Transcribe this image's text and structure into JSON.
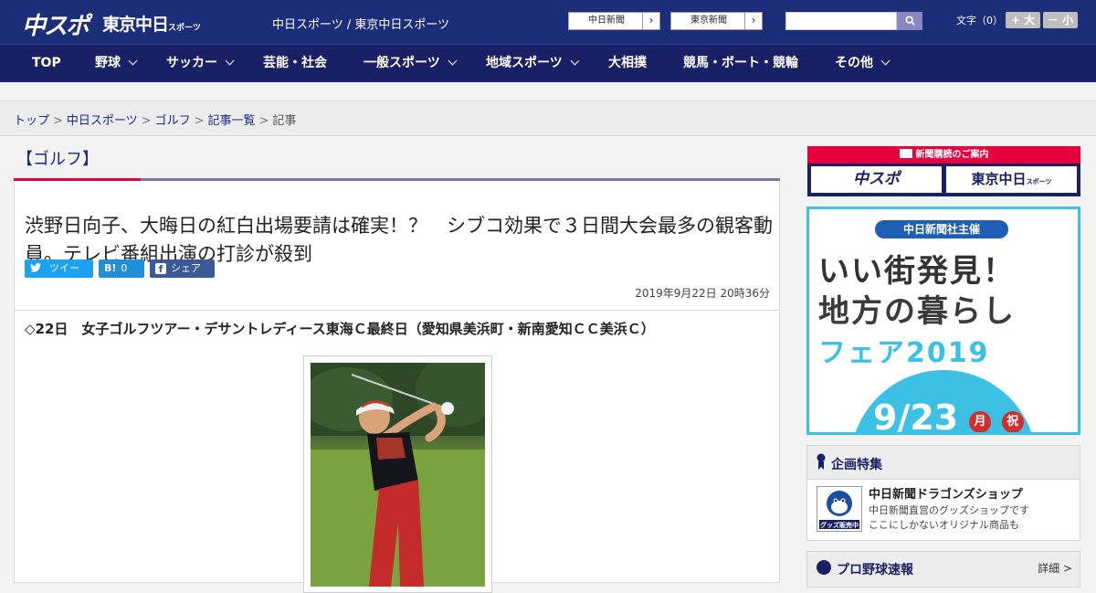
{
  "colors": {
    "header_bg": "#1c2e7a",
    "nav_bg": "#1a2065",
    "accent_red": "#e6003e",
    "accent_purple": "#7a73b0",
    "link_blue": "#1a2a8a",
    "share_blue": "#1da1f2",
    "fair_cyan": "#3cc0e6"
  },
  "header": {
    "logo_chusupo": "中スポ",
    "logo_tokyo": "東京中日",
    "logo_tokyo_suffix": "スポーツ",
    "site_name": "中日スポーツ / 東京中日スポーツ",
    "paper_links": [
      {
        "label": "中日新聞"
      },
      {
        "label": "東京新聞"
      }
    ],
    "search": {
      "placeholder": "",
      "icon": "search-icon"
    },
    "font_size_label": "文字（0）",
    "font_larger": "+ 大",
    "font_smaller": "－ 小"
  },
  "nav": {
    "items": [
      {
        "label": "TOP",
        "has_menu": false
      },
      {
        "label": "野球",
        "has_menu": true
      },
      {
        "label": "サッカー",
        "has_menu": true
      },
      {
        "label": "芸能・社会",
        "has_menu": false
      },
      {
        "label": "一般スポーツ",
        "has_menu": true
      },
      {
        "label": "地域スポーツ",
        "has_menu": true
      },
      {
        "label": "大相撲",
        "has_menu": false
      },
      {
        "label": "競馬・ボート・競輪",
        "has_menu": false
      },
      {
        "label": "その他",
        "has_menu": true
      }
    ]
  },
  "breadcrumb": {
    "items": [
      "トップ",
      "中日スポーツ",
      "ゴルフ",
      "記事一覧"
    ],
    "current": "記事"
  },
  "article": {
    "category": "【ゴルフ】",
    "title": "渋野日向子、大晦日の紅白出場要請は確実！？　シブコ効果で３日間大会最多の観客動員。テレビ番組出演の打診が殺到",
    "share": {
      "tweet": "ツイート",
      "hatena_count": "0",
      "facebook": "シェア 0"
    },
    "date": "2019年9月22日 20時36分",
    "lead": "◇22日　女子ゴルフツアー・デサントレディース東海Ｃ最終日（愛知県美浜町・新南愛知ＣＣ美浜Ｃ）"
  },
  "sidebar": {
    "subscribe": {
      "header": "新聞購読のご案内",
      "buttons": [
        "中スポ",
        "東京中日"
      ],
      "tokyo_suffix": "スポーツ"
    },
    "fair": {
      "tag": "中日新聞社主催",
      "line1": "いい街発見！",
      "line2": "地方の暮らし",
      "line3": "フェア2019",
      "date": "9/23",
      "dow1": "月",
      "dow2": "祝"
    },
    "feature": {
      "title": "企画特集",
      "shop_title": "中日新聞ドラゴンズショップ",
      "shop_desc_1": "中日新聞直営のグッズショップです",
      "shop_desc_2": "ここにしかないオリジナル商品も",
      "shop_thumb_text": "グッズ販売中"
    },
    "baseball": {
      "title": "プロ野球速報",
      "link": "詳細 >"
    }
  }
}
